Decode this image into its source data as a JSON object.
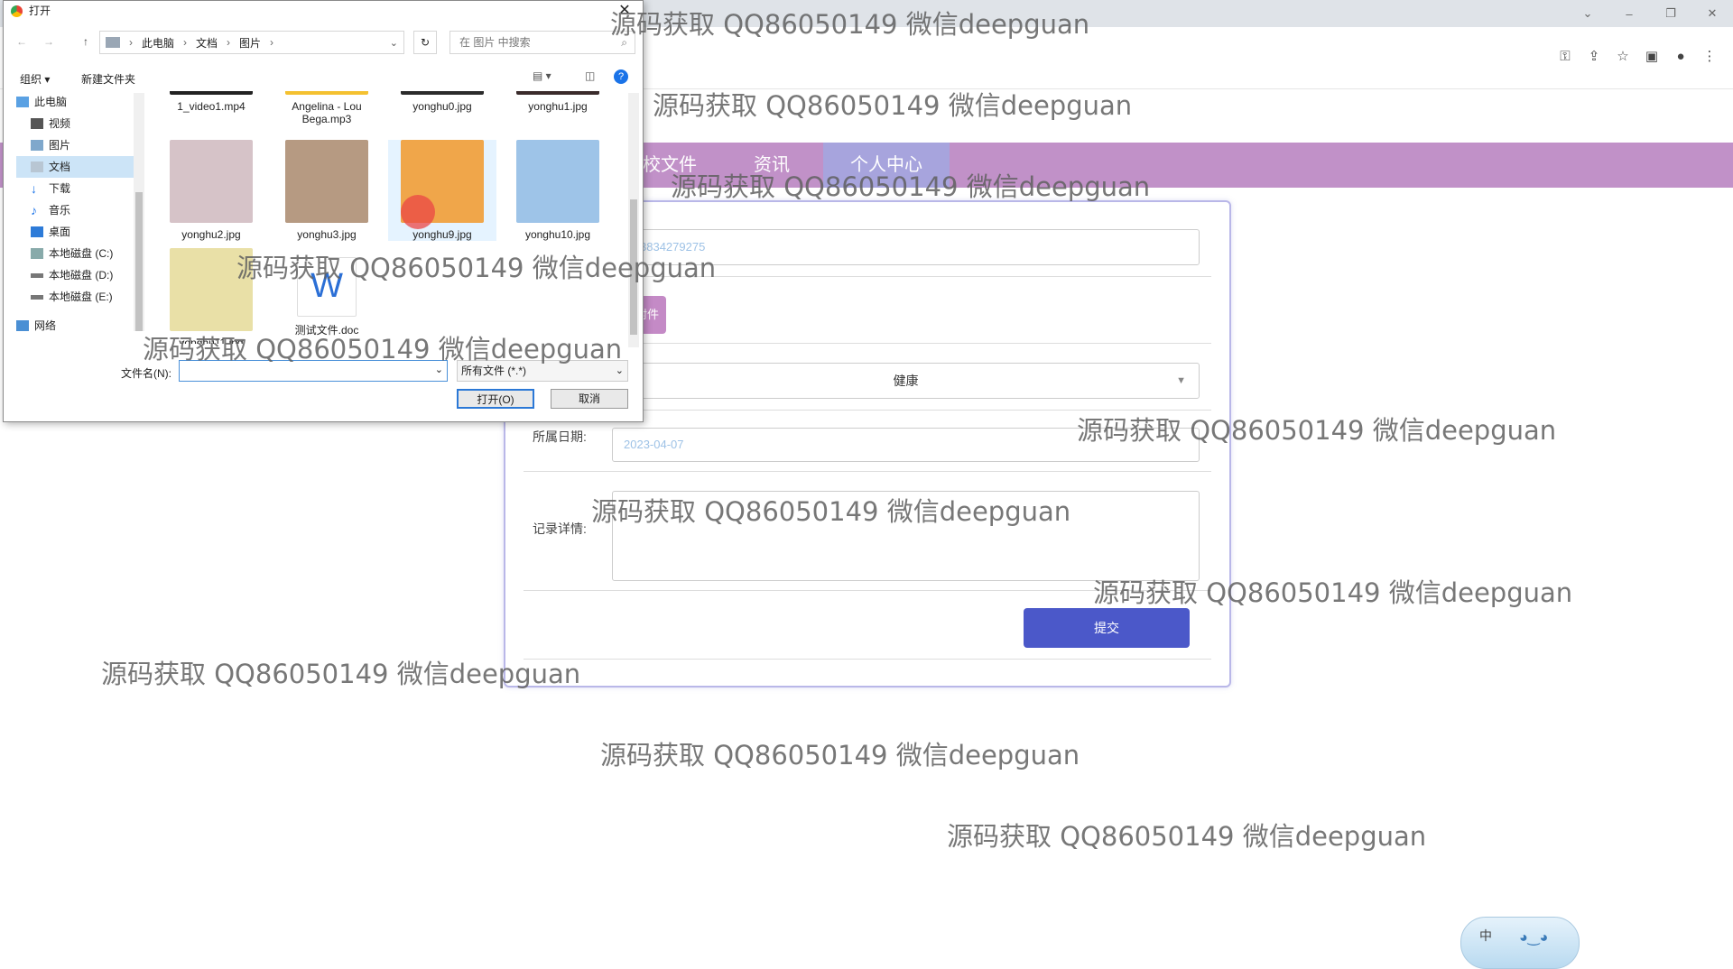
{
  "dialog": {
    "title": "打开",
    "breadcrumb": [
      "此电脑",
      "文档",
      "图片"
    ],
    "search_placeholder": "在 图片 中搜索",
    "organize": "组织",
    "new_folder": "新建文件夹",
    "sidebar": [
      "此电脑",
      "视频",
      "图片",
      "文档",
      "下载",
      "音乐",
      "桌面",
      "本地磁盘 (C:)",
      "本地磁盘 (D:)",
      "本地磁盘 (E:)",
      "网络"
    ],
    "sidebar_selected": "文档",
    "files": [
      {
        "name": "1_video1.mp4",
        "color": "#222222"
      },
      {
        "name": "Angelina - Lou Bega.mp3",
        "color": "#f4c130"
      },
      {
        "name": "yonghu0.jpg",
        "color": "#2b2b2b"
      },
      {
        "name": "yonghu1.jpg",
        "color": "#3a2b2b"
      },
      {
        "name": "yonghu2.jpg",
        "color": "#d6c3c8"
      },
      {
        "name": "yonghu3.jpg",
        "color": "#b69a82"
      },
      {
        "name": "yonghu9.jpg",
        "color": "#f0a64a"
      },
      {
        "name": "yonghu10.jpg",
        "color": "#9ec4e8"
      },
      {
        "name": "yonghu11.jpg",
        "color": "#e9e0a7"
      },
      {
        "name": "测试文件.doc",
        "color": "#2b6fd6"
      }
    ],
    "filename_label": "文件名(N):",
    "filename_value": "",
    "filter_value": "所有文件 (*.*)",
    "open_btn": "打开(O)",
    "cancel_btn": "取消"
  },
  "nav": {
    "items": [
      "校文件",
      "资讯",
      "个人中心"
    ],
    "active": "个人中心"
  },
  "form": {
    "phone_value": "3834279275",
    "upload_label": "附件",
    "select_value": "健康",
    "date_label": "所属日期:",
    "date_value": "2023-04-07",
    "detail_label": "记录详情:",
    "detail_value": "",
    "submit_label": "提交"
  },
  "ime": {
    "label": "中"
  },
  "watermark": "源码获取 QQ86050149 微信deepguan"
}
